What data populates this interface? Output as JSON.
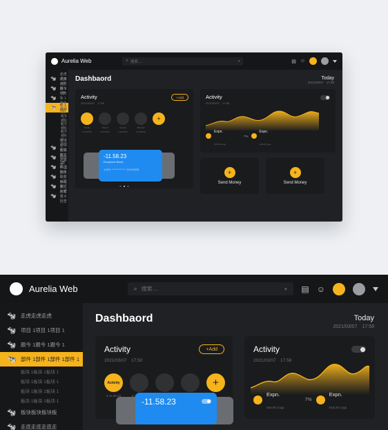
{
  "app": {
    "name": "Aurelia Web",
    "logo_icon": "circle-logo-icon"
  },
  "search": {
    "placeholder": "搜索....",
    "icon": "search-icon",
    "dropdown_icon": "chevron-down-icon"
  },
  "topbar": {
    "calculator_icon": "calculator-icon",
    "help_icon": "help-circle-icon",
    "avatar_primary": "avatar-yellow",
    "avatar_secondary": "avatar-grey",
    "menu_caret_icon": "caret-down-icon",
    "accent_color": "#f5b31c"
  },
  "sidebar": {
    "items": [
      {
        "label": "走虎走虎走虎",
        "icon": "cow-icon",
        "active": false,
        "sub": false
      },
      {
        "label": "项目 1项目 1项目 1",
        "icon": "cow-icon",
        "active": false,
        "sub": false
      },
      {
        "label": "跟今 1跟今 1跟今 1",
        "icon": "cow-icon",
        "active": false,
        "sub": false
      },
      {
        "label": "部件 1部件 1部件 1部件 1",
        "icon": "cow-icon",
        "active": true,
        "sub": false
      },
      {
        "label": "板块 1板块 1板块 1",
        "icon": "",
        "active": false,
        "sub": true
      },
      {
        "label": "板块 1板块 1板块 1",
        "icon": "",
        "active": false,
        "sub": true
      },
      {
        "label": "板块 1板块 1板块 1",
        "icon": "",
        "active": false,
        "sub": true
      },
      {
        "label": "板块 1板块 1板块 1",
        "icon": "",
        "active": false,
        "sub": true
      },
      {
        "label": "板块板块板块板",
        "icon": "cow-icon",
        "active": false,
        "sub": false
      },
      {
        "label": "走底走底走底走",
        "icon": "cow-icon",
        "active": false,
        "sub": false
      },
      {
        "label": "部件 1部件 1部件 1",
        "icon": "cow-icon",
        "active": false,
        "sub": false
      },
      {
        "label": "41国际水球要水球要",
        "icon": "cow-icon",
        "active": false,
        "sub": false
      },
      {
        "label": "板框板框板框",
        "icon": "cow-icon",
        "active": false,
        "sub": false
      },
      {
        "label": "大变量大检查",
        "icon": "cow-icon",
        "active": false,
        "sub": false
      }
    ]
  },
  "main": {
    "page_title": "Dashbaord",
    "today_label": "Today",
    "today_caret_icon": "caret-down-icon",
    "today_datetime": "2021/03/07　17:58"
  },
  "activity_card": {
    "title": "Activity",
    "datetime": "2021/03/07　17:50",
    "add_label": "+Add",
    "avatars": [
      {
        "name": "Activity",
        "amount": "¥ 11,58.23",
        "highlight": true
      },
      {
        "name": "Darrell",
        "amount": "¥ 11,58.23",
        "highlight": false
      },
      {
        "name": "Annette",
        "amount": "¥ 11,58.23",
        "highlight": false
      },
      {
        "name": "Bernard",
        "amount": "¥ 11,58.23",
        "highlight": false
      },
      {
        "name": "Add",
        "amount": "¥ 11,58.23",
        "highlight": false
      }
    ],
    "add_avatar_icon": "plus-icon"
  },
  "card_widget": {
    "amount": "-11.58.23",
    "holder": "Ezequiele Black",
    "number": "1400 ********** 2023558",
    "toggle_icon": "toggle-switch-on",
    "color": "#1f8bf0"
  },
  "pager": {
    "dots": 3,
    "active_index": 1
  },
  "chart_card": {
    "title": "Activity",
    "datetime": "2021/03/07　17:58",
    "toggle_icon": "toggle-switch-off",
    "stats": [
      {
        "label": "Expn.",
        "sub": "¥18,05  Cogs",
        "percent": ""
      },
      {
        "label": "Expn.",
        "sub": "¥18,26  Cogs",
        "percent": "7%"
      }
    ],
    "legend_color": "#f5b31c"
  },
  "money_buttons": [
    {
      "label": "Send Money",
      "icon": "plus-icon"
    },
    {
      "label": "Send Money",
      "icon": "plus-icon"
    }
  ],
  "chart_data": {
    "type": "area",
    "title": "Activity",
    "x": [
      0,
      1,
      2,
      3,
      4,
      5,
      6,
      7,
      8,
      9,
      10,
      11,
      12,
      13,
      14,
      15,
      16
    ],
    "values": [
      18,
      24,
      30,
      26,
      34,
      46,
      40,
      33,
      38,
      52,
      58,
      48,
      42,
      50,
      57,
      46,
      38
    ],
    "ylim": [
      0,
      64
    ],
    "grid": false,
    "legend": [
      "Expn."
    ],
    "xlabel": "",
    "ylabel": ""
  }
}
